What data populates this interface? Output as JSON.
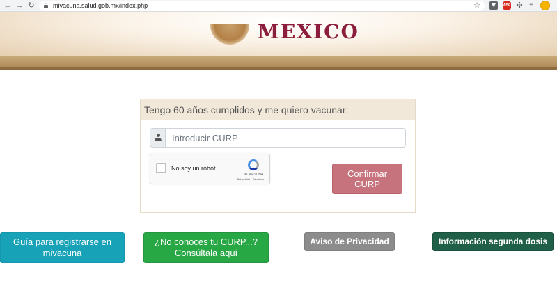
{
  "browser": {
    "url": "mivacuna.salud.gob.mx/index.php",
    "extensions": {
      "abp_label": "ABP"
    },
    "icons": {
      "back": "arrow-left-icon",
      "forward": "arrow-right-icon",
      "reload": "reload-icon",
      "lock": "lock-icon",
      "star": "star-icon",
      "download": "download-icon",
      "puzzle": "puzzle-icon",
      "media": "media-icon"
    }
  },
  "header": {
    "brand": "MEXICO",
    "brand_color": "#8c1d3d"
  },
  "form": {
    "title": "Tengo 60 años cumplidos y me quiero vacunar:",
    "curp_placeholder": "Introducir CURP",
    "curp_value": "",
    "captcha": {
      "label": "No soy un robot",
      "brand": "reCAPTCHA",
      "links": "Privacidad - Términos",
      "checked": false
    },
    "confirm_label": "Confirmar CURP",
    "confirm_color": "#c6737e"
  },
  "actions": [
    {
      "label": "Guía para registrarse en mivacuna",
      "color": "#17a2b8"
    },
    {
      "label": "¿No conoces tu CURP...? Consúltala aquí",
      "color": "#28a745"
    },
    {
      "label": "Aviso de Privacidad",
      "color": "#8c8c8c"
    },
    {
      "label": "Información segunda dosis",
      "color": "#205f48"
    }
  ]
}
